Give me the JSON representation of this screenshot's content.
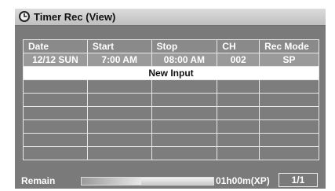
{
  "window": {
    "title": "Timer Rec (View)",
    "icon": "clock-icon"
  },
  "table": {
    "headers": [
      "Date",
      "Start",
      "Stop",
      "CH",
      "Rec Mode"
    ],
    "rows": [
      [
        "12/12 SUN",
        "7:00 AM",
        "08:00 AM",
        "002",
        "SP"
      ]
    ],
    "new_input_label": "New Input",
    "empty_rows": 6
  },
  "footer": {
    "remain_label": "Remain",
    "remain_fraction": 0.45,
    "remain_value": "01h00m(XP)",
    "page": "1/1"
  }
}
